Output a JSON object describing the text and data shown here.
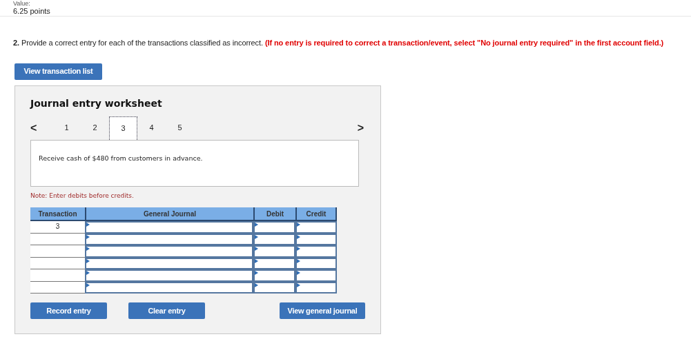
{
  "header": {
    "label": "Value:",
    "points": "6.25 points"
  },
  "question": {
    "number": "2.",
    "text": "Provide a correct entry for each of the transactions classified as incorrect.",
    "instruction": "(If no entry is required to correct a transaction/event, select \"No journal entry required\" in the first account field.)"
  },
  "view_transaction_button": "View transaction list",
  "worksheet": {
    "title": "Journal entry worksheet",
    "prev": "<",
    "next": ">",
    "tabs": [
      {
        "label": "1",
        "selected": false
      },
      {
        "label": "2",
        "selected": false
      },
      {
        "label": "3",
        "selected": true
      },
      {
        "label": "4",
        "selected": false
      },
      {
        "label": "5",
        "selected": false
      }
    ],
    "description": "Receive cash of $480 from customers in advance.",
    "note": "Note: Enter debits before credits.",
    "table": {
      "columns": [
        "Transaction",
        "General Journal",
        "Debit",
        "Credit"
      ],
      "rows": [
        {
          "transaction": "3"
        },
        {},
        {},
        {},
        {},
        {}
      ]
    },
    "buttons": {
      "record": "Record entry",
      "clear": "Clear entry",
      "view_journal": "View general journal"
    }
  }
}
